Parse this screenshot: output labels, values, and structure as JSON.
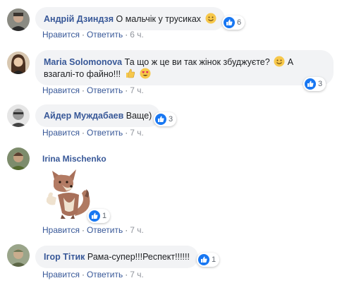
{
  "accent": "#385898",
  "like_color": "#1877f2",
  "comments": [
    {
      "author": "Андрій Дзиндзя",
      "text": "О мальчік у трусиках",
      "emoji": "smile-emoji",
      "likes": "6",
      "actions": {
        "like": "Нравится",
        "reply": "Ответить",
        "time": "6 ч."
      }
    },
    {
      "author": "Maria Solomonova",
      "text": "Та що ж це ви так жінок збуджуєте?",
      "text2": "А",
      "text3": "взагалі-то файно!!!",
      "likes": "3",
      "actions": {
        "like": "Нравится",
        "reply": "Ответить",
        "time": "7 ч."
      }
    },
    {
      "author": "Айдер Муждабаев",
      "text": "Ваще)",
      "likes": "3",
      "actions": {
        "like": "Нравится",
        "reply": "Ответить",
        "time": "7 ч."
      }
    },
    {
      "author": "Irina Mischenko",
      "sticker": "fox-thumbs-up-sticker",
      "likes": "1",
      "actions": {
        "like": "Нравится",
        "reply": "Ответить",
        "time": "7 ч."
      }
    },
    {
      "author": "Ігор Тітик",
      "text": "Рама-супер!!!Респект!!!!!!",
      "likes": "1",
      "actions": {
        "like": "Нравится",
        "reply": "Ответить",
        "time": "7 ч."
      }
    }
  ]
}
